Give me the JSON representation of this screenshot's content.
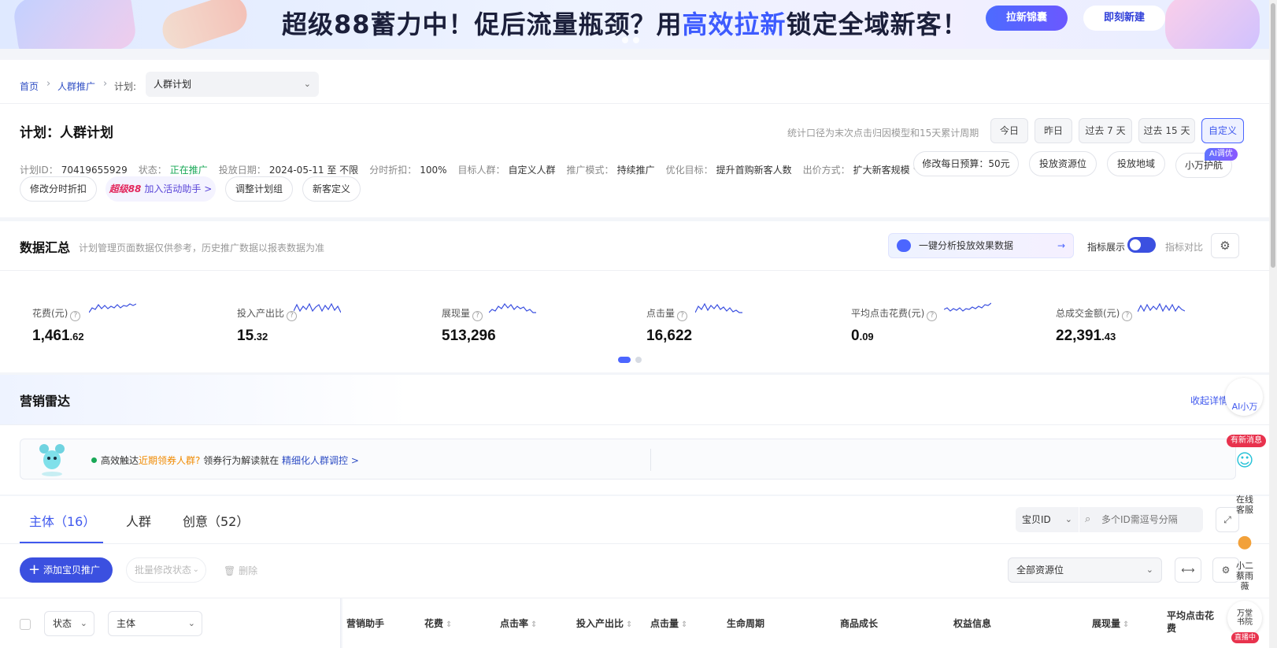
{
  "banner": {
    "title_pre": "超级88蓄力中！促后流量瓶颈？用",
    "title_highlight": "高效拉新",
    "title_post": "锁定全域新客！",
    "btn_primary": "拉新锦囊",
    "btn_secondary": "即刻新建"
  },
  "breadcrumb": {
    "home": "首页",
    "level2": "人群推广",
    "plan_label": "计划:",
    "plan_select": "人群计划"
  },
  "plan": {
    "title": "计划：人群计划",
    "stat_hint": "统计口径为末次点击归因模型和15天累计周期",
    "date_buttons": [
      "今日",
      "昨日",
      "过去 7 天",
      "过去 15 天",
      "自定义"
    ],
    "active_date": "自定义",
    "meta": [
      {
        "label": "计划ID：",
        "value": "70419655929"
      },
      {
        "label": "状态：",
        "value": "正在推广"
      },
      {
        "label": "投放日期：",
        "value": "2024-05-11 至 不限"
      },
      {
        "label": "分时折扣：",
        "value": "100%"
      },
      {
        "label": "目标人群：",
        "value": "自定义人群"
      },
      {
        "label": "推广模式：",
        "value": "持续推广"
      },
      {
        "label": "优化目标：",
        "value": "提升首购新客人数"
      },
      {
        "label": "出价方式：",
        "value": "扩大新客规模"
      }
    ],
    "actions_right": [
      "修改每日预算：50元",
      "投放资源位",
      "投放地域",
      "小万护航"
    ],
    "ai_tag": "AI调优",
    "actions_left": [
      "修改分时折扣",
      "调整计划组",
      "新客定义"
    ],
    "activity_brand": "超级88",
    "activity_text": "加入活动助手 >"
  },
  "summary": {
    "title": "数据汇总",
    "note": "计划管理页面数据仅供参考，历史推广数据以报表数据为准",
    "ai_analyze": "一键分析投放效果数据",
    "indicator_show": "指标展示",
    "indicator_compare": "指标对比",
    "metrics": [
      {
        "label": "花费(元)",
        "int": "1,461",
        "dec": ".62"
      },
      {
        "label": "投入产出比",
        "int": "15",
        "dec": ".32"
      },
      {
        "label": "展现量",
        "int": "513,296",
        "dec": ""
      },
      {
        "label": "点击量",
        "int": "16,622",
        "dec": ""
      },
      {
        "label": "平均点击花费(元)",
        "int": "0",
        "dec": ".09"
      },
      {
        "label": "总成交金额(元)",
        "int": "22,391",
        "dec": ".43"
      }
    ]
  },
  "radar": {
    "title": "营销雷达",
    "collapse": "收起详情",
    "text_pre": "高效触达",
    "text_highlight": "近期领券人群?",
    "text_mid": " 领券行为解读就在 ",
    "text_link": "精细化人群调控 >"
  },
  "tabs": {
    "items": [
      "主体（16）",
      "人群",
      "创意（52）"
    ],
    "active": 0,
    "id_select": "宝贝ID",
    "id_placeholder": "多个ID需逗号分隔",
    "add_button": "添加宝贝推广",
    "batch_status": "批量修改状态",
    "delete": "删除",
    "resource_select": "全部资源位",
    "filter_status": "状态",
    "filter_subject": "主体",
    "columns": [
      "营销助手",
      "花费",
      "点击率",
      "投入产出比",
      "点击量",
      "生命周期",
      "商品成长",
      "权益信息",
      "展现量",
      "平均点击花费"
    ]
  },
  "side": {
    "ai": "AI小万",
    "new_msg": "有新消息",
    "service": "在线客服",
    "xiaoer": "小二蔡雨薇",
    "academy": "万堂书院",
    "live": "直播中"
  },
  "colors": {
    "accent": "#3b50e0",
    "green": "#19a857",
    "orange": "#f08a00"
  },
  "icons": [
    "chevron-down-icon",
    "help-icon",
    "gear-icon",
    "search-icon",
    "plus-icon",
    "trash-icon",
    "edit-icon",
    "expand-icon"
  ]
}
